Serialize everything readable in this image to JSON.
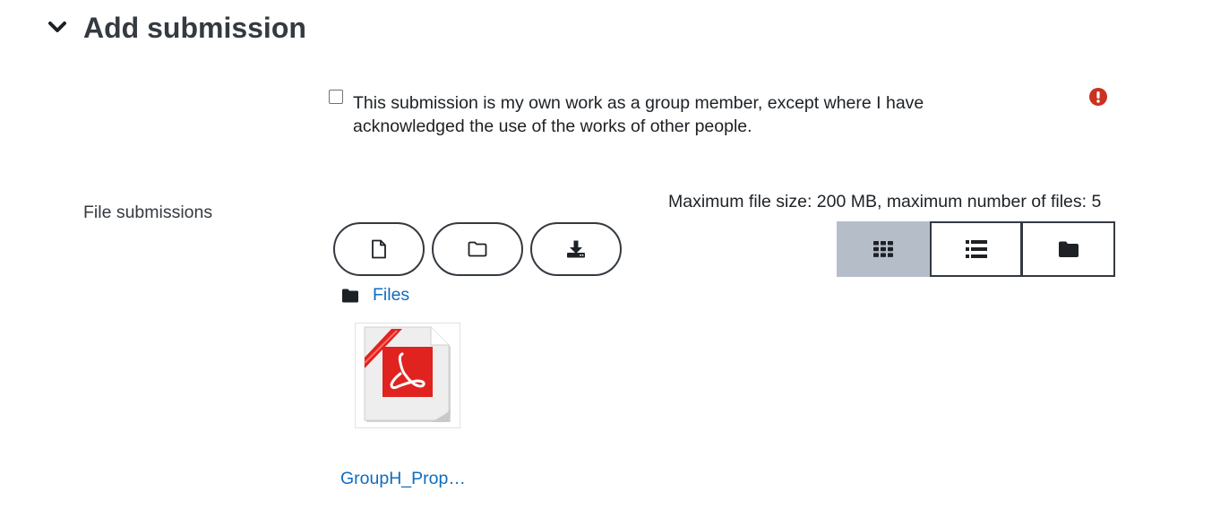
{
  "section": {
    "title": "Add submission",
    "toggle_icon": "chevron-down-icon"
  },
  "statement": {
    "text": "This submission is my own work as a group member, except where I have acknowledged the use of the works of other people.",
    "checked": false,
    "required_icon": "exclamation-circle-icon",
    "required_color": "#ca3120"
  },
  "file_submissions": {
    "label": "File submissions",
    "limits": "Maximum file size: 200 MB, maximum number of files: 5",
    "actions": [
      {
        "name": "add-file",
        "icon": "file-icon"
      },
      {
        "name": "create-folder",
        "icon": "folder-outline-icon"
      },
      {
        "name": "download-all",
        "icon": "download-icon"
      }
    ],
    "views": [
      {
        "name": "icons",
        "icon": "grid-icon",
        "active": true
      },
      {
        "name": "details",
        "icon": "list-icon",
        "active": false
      },
      {
        "name": "tree",
        "icon": "folder-icon",
        "active": false
      }
    ],
    "path": {
      "icon": "folder-icon",
      "label": "Files"
    },
    "files": [
      {
        "name": "GroupH_Prop…",
        "type": "pdf",
        "icon": "pdf-file-icon"
      }
    ]
  },
  "colors": {
    "link": "#0f6cbf",
    "active_view": "#b5bec8",
    "pdf_red": "#e0231f"
  }
}
